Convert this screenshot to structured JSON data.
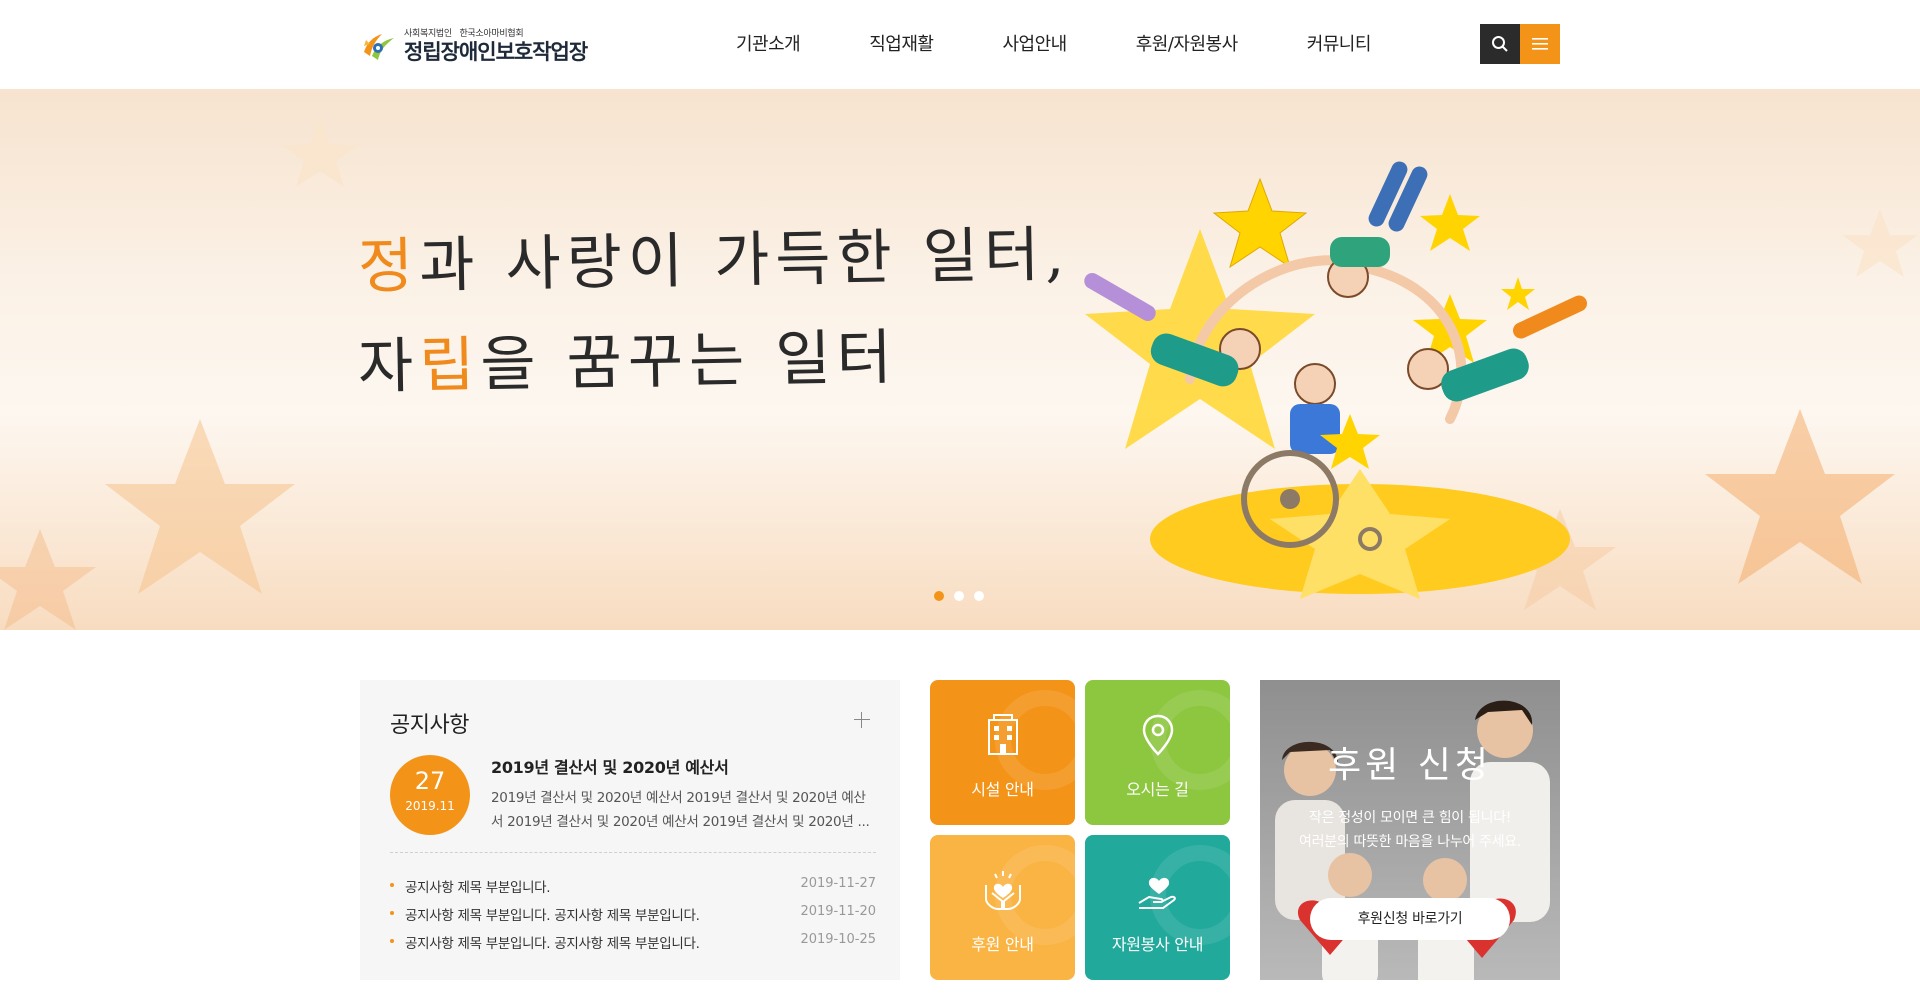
{
  "header": {
    "logo": {
      "sub_left": "사회복지법인",
      "sub_right": "한국소아마비협회",
      "name": "정립장애인보호작업장"
    },
    "nav": [
      "기관소개",
      "직업재활",
      "사업안내",
      "후원/자원봉사",
      "커뮤니티"
    ],
    "icons": {
      "search": "search-icon",
      "menu": "hamburger-menu-icon"
    },
    "colors": {
      "search_bg": "#2b2b2b",
      "menu_bg": "#f39419"
    }
  },
  "hero": {
    "line1_accent": "정",
    "line1_rest": "과 사랑이 가득한 일터,",
    "line2_before": "자",
    "line2_accent": "립",
    "line2_after": "을 꿈꾸는 일터",
    "slides": 3,
    "active_slide": 1
  },
  "notice": {
    "title": "공지사항",
    "more_icon": "plus-icon",
    "featured": {
      "day": "27",
      "year_month": "2019.11",
      "title": "2019년 결산서 및 2020년 예산서",
      "desc_line1": "2019년 결산서 및 2020년 예산서 2019년 결산서 및 2020년 예산",
      "desc_line2": "서 2019년 결산서 및 2020년 예산서 2019년 결산서 및 2020년 ..."
    },
    "items": [
      {
        "title": "공지사항 제목 부분입니다.",
        "date": "2019-11-27"
      },
      {
        "title": "공지사항 제목 부분입니다. 공지사항 제목 부분입니다.",
        "date": "2019-11-20"
      },
      {
        "title": "공지사항 제목 부분입니다. 공지사항 제목 부분입니다.",
        "date": "2019-10-25"
      }
    ]
  },
  "quick_links": [
    {
      "label": "시설 안내",
      "icon": "building-icon",
      "color": "#f39419"
    },
    {
      "label": "오시는 길",
      "icon": "map-pin-icon",
      "color": "#8dc63f"
    },
    {
      "label": "후원 안내",
      "icon": "heart-hands-icon",
      "color": "#fab444"
    },
    {
      "label": "자원봉사 안내",
      "icon": "heart-hand-icon",
      "color": "#21a99b"
    }
  ],
  "donation": {
    "title": "후원 신청",
    "text_line1": "작은 정성이 모이면 큰 힘이 됩니다!",
    "text_line2": "여러분의 따뜻한 마음을 나누어 주세요.",
    "button": "후원신청 바로가기"
  },
  "colors": {
    "accent": "#f39419",
    "green": "#8dc63f",
    "yellow": "#fab444",
    "teal": "#21a99b"
  }
}
